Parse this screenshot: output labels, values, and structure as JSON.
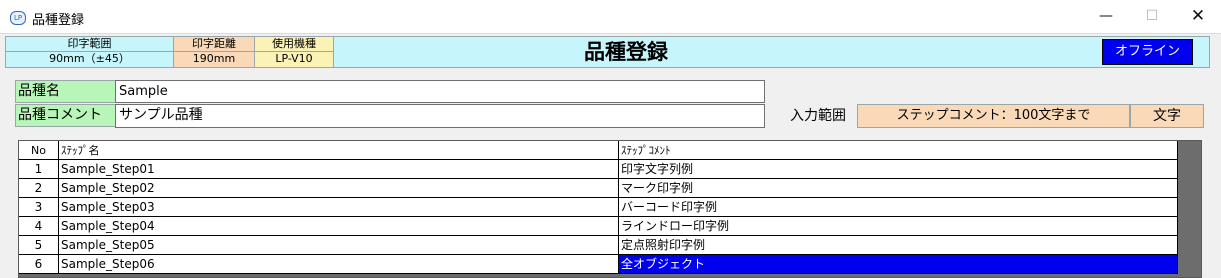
{
  "window": {
    "icon_text": "LP",
    "title": "品種登録",
    "minimize_glyph": "—",
    "maximize_glyph": "☐",
    "close_glyph": "✕"
  },
  "info": {
    "print_range_label": "印字範囲",
    "print_range_value": "90mm（±45）",
    "print_distance_label": "印字距離",
    "print_distance_value": "190mm",
    "model_label": "使用機種",
    "model_value": "LP-V10",
    "heading": "品種登録",
    "status": "オフライン"
  },
  "form": {
    "name_label": "品種名",
    "name_value": "Sample",
    "comment_label": "品種コメント",
    "comment_value": "サンプル品種",
    "input_range_label": "入力範囲",
    "input_range_value": "ステップコメント：100文字まで",
    "input_range_unit": "文字"
  },
  "table": {
    "headers": {
      "no": "No",
      "name": "ｽﾃｯﾌﾟ名",
      "comment": "ｽﾃｯﾌﾟｺﾒﾝﾄ"
    },
    "rows": [
      {
        "no": "1",
        "name": "Sample_Step01",
        "comment": "印字文字列例"
      },
      {
        "no": "2",
        "name": "Sample_Step02",
        "comment": "マーク印字例"
      },
      {
        "no": "3",
        "name": "Sample_Step03",
        "comment": "バーコード印字例"
      },
      {
        "no": "4",
        "name": "Sample_Step04",
        "comment": "ラインドロー印字例"
      },
      {
        "no": "5",
        "name": "Sample_Step05",
        "comment": "定点照射印字例"
      },
      {
        "no": "6",
        "name": "Sample_Step06",
        "comment": "全オブジェクト"
      }
    ]
  },
  "colors": {
    "info_bar": "#c6f6fb",
    "distance_cell": "#f9d9b8",
    "model_cell": "#fbf3b5",
    "label_green": "#b8f5b8",
    "status_blue": "#0000ee",
    "grid_background": "#6d6d6d"
  }
}
